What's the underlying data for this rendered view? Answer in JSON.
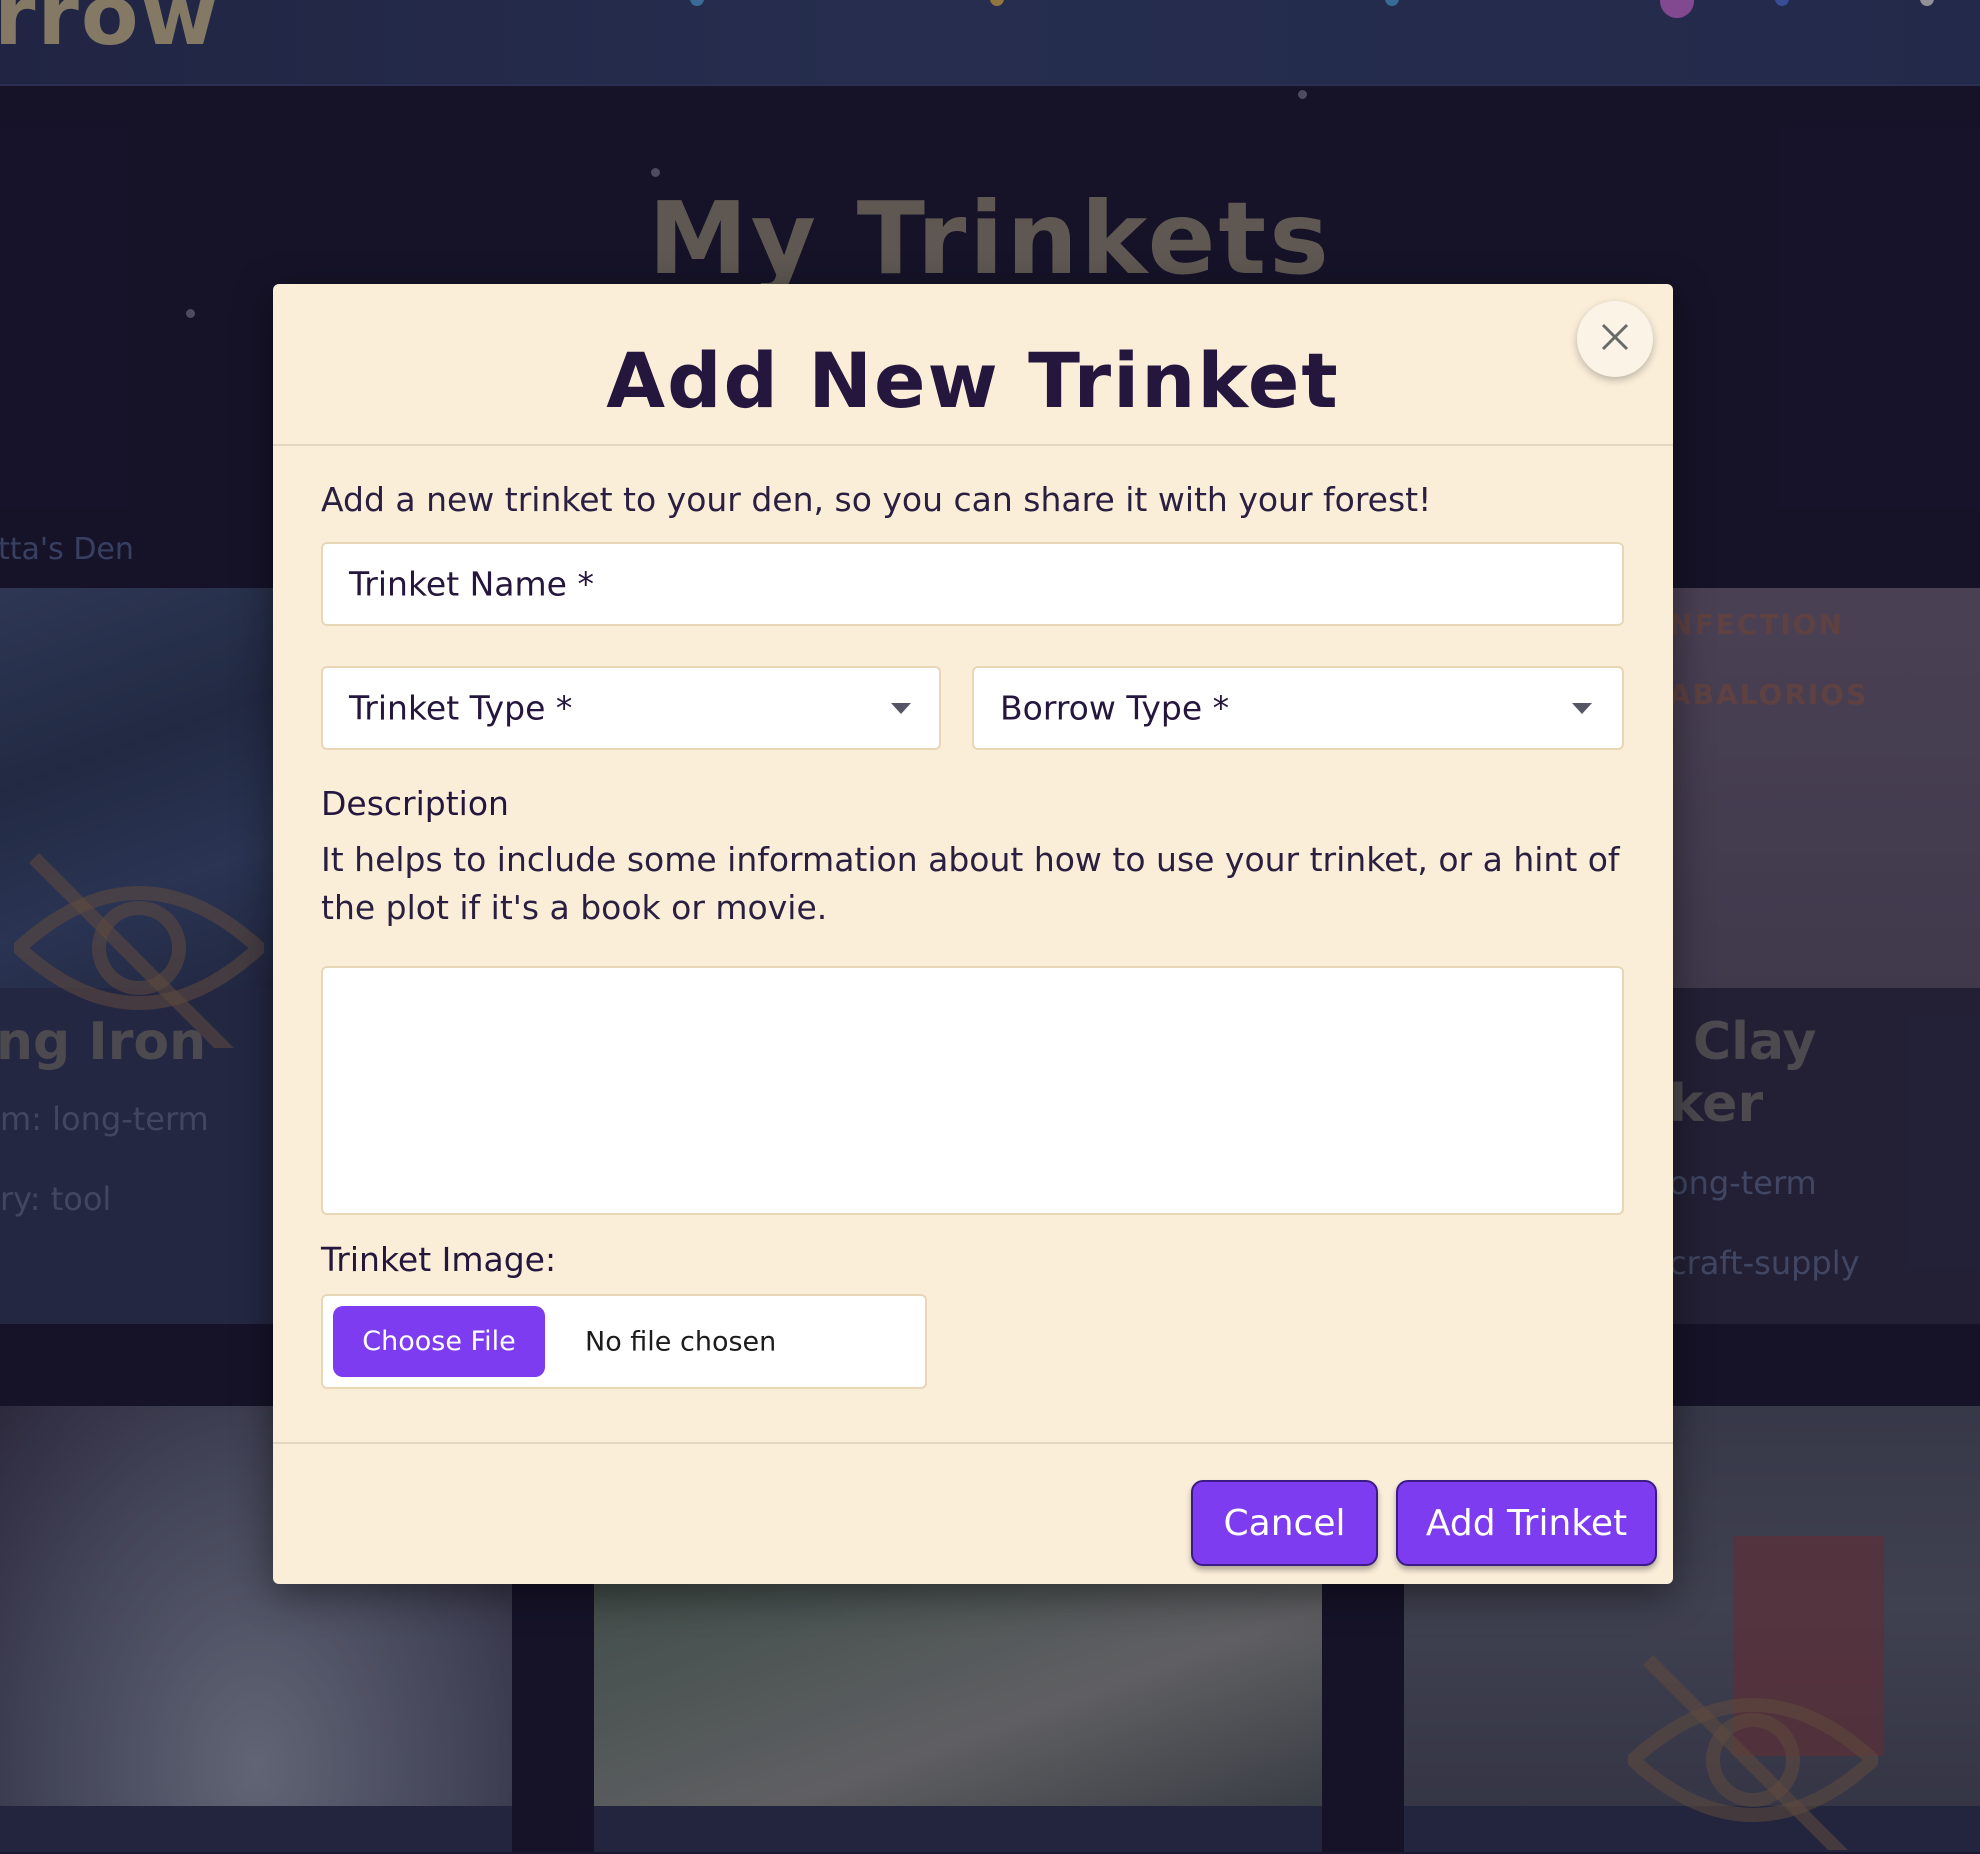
{
  "background": {
    "brand_text": "rrow",
    "page_title": "My Trinkets",
    "den_label": "tta's Den",
    "cards": [
      {
        "title": "ng Iron",
        "meta1": "m: long-term",
        "meta2": "ry: tool"
      },
      {
        "title_line1": "Clay",
        "title_line2": "ker",
        "meta1": "ong-term",
        "meta2": "craft-supply",
        "image_text1": "NFECTION",
        "image_text2": "ABALORIOS"
      }
    ]
  },
  "modal": {
    "title": "Add New Trinket",
    "close_icon": "close-icon",
    "intro": "Add a new trinket to your den, so you can share it with your forest!",
    "name_field": {
      "label": "Trinket Name *",
      "value": ""
    },
    "type_field": {
      "label": "Trinket Type *",
      "value": ""
    },
    "borrow_field": {
      "label": "Borrow Type *",
      "value": ""
    },
    "description": {
      "label": "Description",
      "help": "It helps to include some information about how to use your trinket, or a hint of the plot if it's a book or movie.",
      "value": ""
    },
    "image": {
      "label": "Trinket Image:",
      "choose_label": "Choose File",
      "status": "No file chosen"
    },
    "buttons": {
      "cancel": "Cancel",
      "submit": "Add Trinket"
    }
  },
  "colors": {
    "accent": "#7d3cf0",
    "modal_bg": "#faeed9",
    "title": "#24163d",
    "page_bg": "#1b1730"
  }
}
